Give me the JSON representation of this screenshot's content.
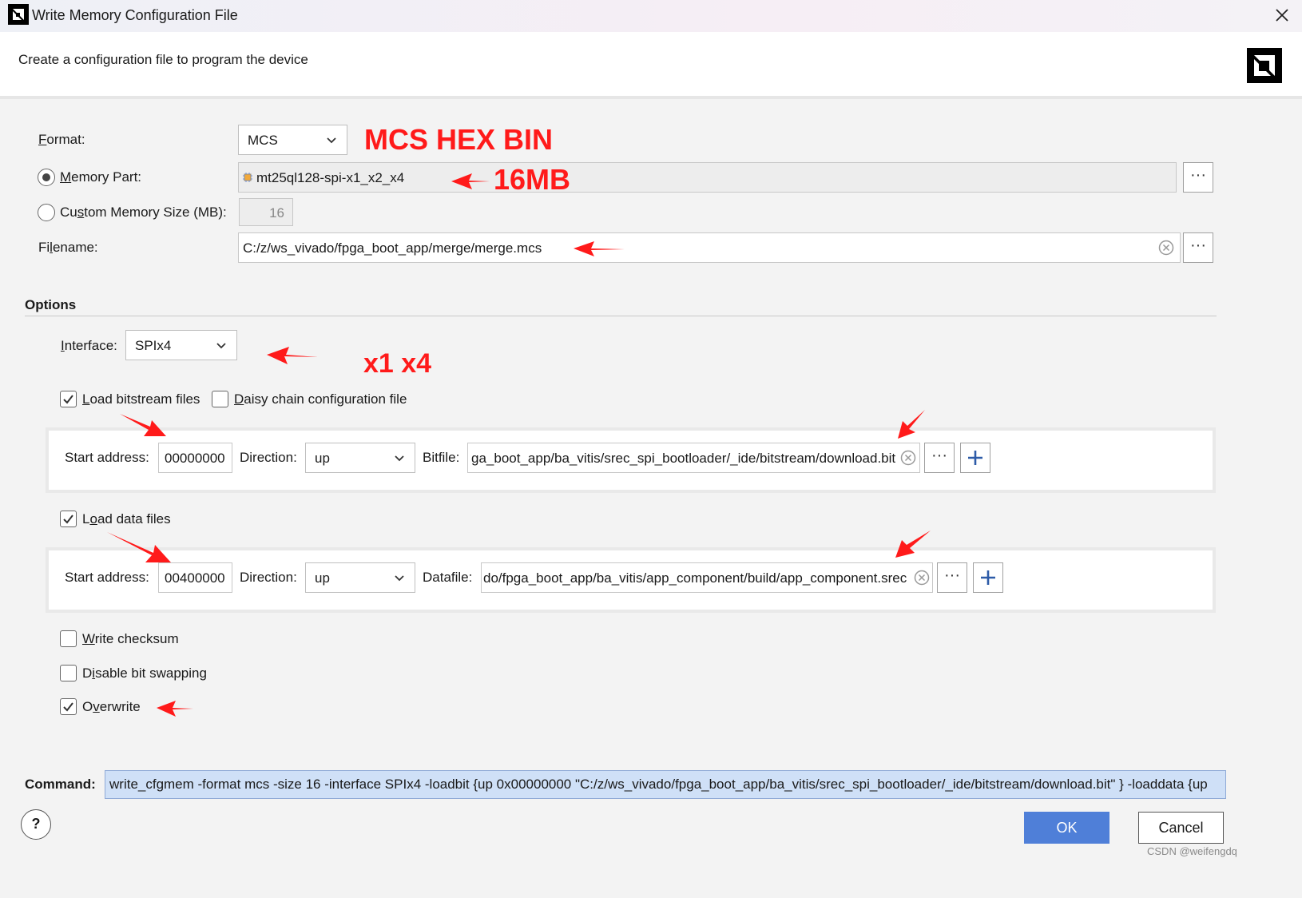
{
  "window": {
    "title": "Write Memory Configuration File",
    "subtitle": "Create a configuration file to program the device"
  },
  "format": {
    "label": "Format:",
    "value": "MCS"
  },
  "memory_part": {
    "label": "Memory Part:",
    "value": "mt25ql128-spi-x1_x2_x4",
    "selected": true
  },
  "custom_size": {
    "label": "Custom Memory Size (MB):",
    "value": "16",
    "selected": false
  },
  "filename": {
    "label": "Filename:",
    "value": "C:/z/ws_vivado/fpga_boot_app/merge/merge.mcs"
  },
  "options": {
    "heading": "Options",
    "interface_label": "Interface:",
    "interface_value": "SPIx4",
    "load_bitstream": {
      "label": "Load bitstream files",
      "checked": true
    },
    "daisy_chain": {
      "label": "Daisy chain configuration file",
      "checked": false
    },
    "bitstream_row": {
      "start_label": "Start address:",
      "start_value": "00000000",
      "dir_label": "Direction:",
      "dir_value": "up",
      "file_label": "Bitfile:",
      "file_value": "ga_boot_app/ba_vitis/srec_spi_bootloader/_ide/bitstream/download.bit"
    },
    "load_data": {
      "label": "Load data files",
      "checked": true
    },
    "data_row": {
      "start_label": "Start address:",
      "start_value": "00400000",
      "dir_label": "Direction:",
      "dir_value": "up",
      "file_label": "Datafile:",
      "file_value": "do/fpga_boot_app/ba_vitis/app_component/build/app_component.srec"
    },
    "write_checksum": {
      "label": "Write checksum",
      "checked": false
    },
    "disable_bit_swapping": {
      "label": "Disable bit swapping",
      "checked": false
    },
    "overwrite": {
      "label": "Overwrite",
      "checked": true
    }
  },
  "command": {
    "label": "Command:",
    "value": "write_cfgmem  -format mcs -size 16 -interface SPIx4 -loadbit {up 0x00000000 \"C:/z/ws_vivado/fpga_boot_app/ba_vitis/srec_spi_bootloader/_ide/bitstream/download.bit\" } -loaddata {up"
  },
  "buttons": {
    "help": "?",
    "ok": "OK",
    "cancel": "Cancel",
    "browse": "···"
  },
  "annotations": {
    "formats": "MCS HEX BIN",
    "size": "16MB",
    "interfaces": "x1 x4"
  },
  "watermark": "CSDN @weifengdq",
  "colors": {
    "annotation": "#ff1a1a",
    "ok_button": "#4f7fd8",
    "command_highlight": "#cfe0f7"
  }
}
